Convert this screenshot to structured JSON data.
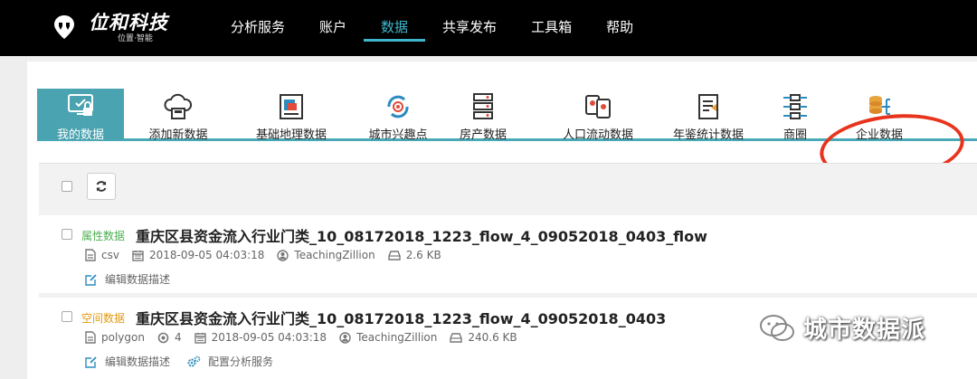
{
  "brand": {
    "name": "位和科技",
    "tagline": "位置·智能"
  },
  "nav": [
    {
      "label": "分析服务"
    },
    {
      "label": "账户"
    },
    {
      "label": "数据",
      "active": true
    },
    {
      "label": "共享发布"
    },
    {
      "label": "工具箱"
    },
    {
      "label": "帮助"
    }
  ],
  "categories": [
    {
      "label": "我的数据",
      "icon": "monitor-lock-icon",
      "active": true
    },
    {
      "label": "添加新数据",
      "icon": "cloud-upload-icon"
    },
    {
      "label": "基础地理数据",
      "icon": "map-document-icon"
    },
    {
      "label": "城市兴趣点",
      "icon": "target-refresh-icon"
    },
    {
      "label": "房产数据",
      "icon": "server-stack-icon"
    },
    {
      "label": "人口流动数据",
      "icon": "people-cards-icon"
    },
    {
      "label": "年鉴统计数据",
      "icon": "yearbook-icon"
    },
    {
      "label": "商圈",
      "icon": "network-grid-icon"
    },
    {
      "label": "企业数据",
      "icon": "database-network-icon"
    }
  ],
  "items": [
    {
      "tag": "属性数据",
      "title": "重庆区县资金流入行业门类_10_08172018_1223_flow_4_09052018_0403_flow",
      "format": "csv",
      "datetime": "2018-09-05 04:03:18",
      "owner": "TeachingZillion",
      "size": "2.6 KB",
      "edit_label": "编辑数据描述"
    },
    {
      "tag": "空间数据",
      "title": "重庆区县资金流入行业门类_10_08172018_1223_flow_4_09052018_0403",
      "format": "polygon",
      "count": "4",
      "datetime": "2018-09-05 04:03:18",
      "owner": "TeachingZillion",
      "size": "240.6 KB",
      "edit_label": "编辑数据描述",
      "config_label": "配置分析服务"
    }
  ],
  "watermark": "城市数据派",
  "colors": {
    "accent": "#3fb6cc",
    "tab_active": "#4aa3b0",
    "annotation": "#e8341c",
    "tag_attr": "#4caf50",
    "tag_space": "#e09a12"
  }
}
